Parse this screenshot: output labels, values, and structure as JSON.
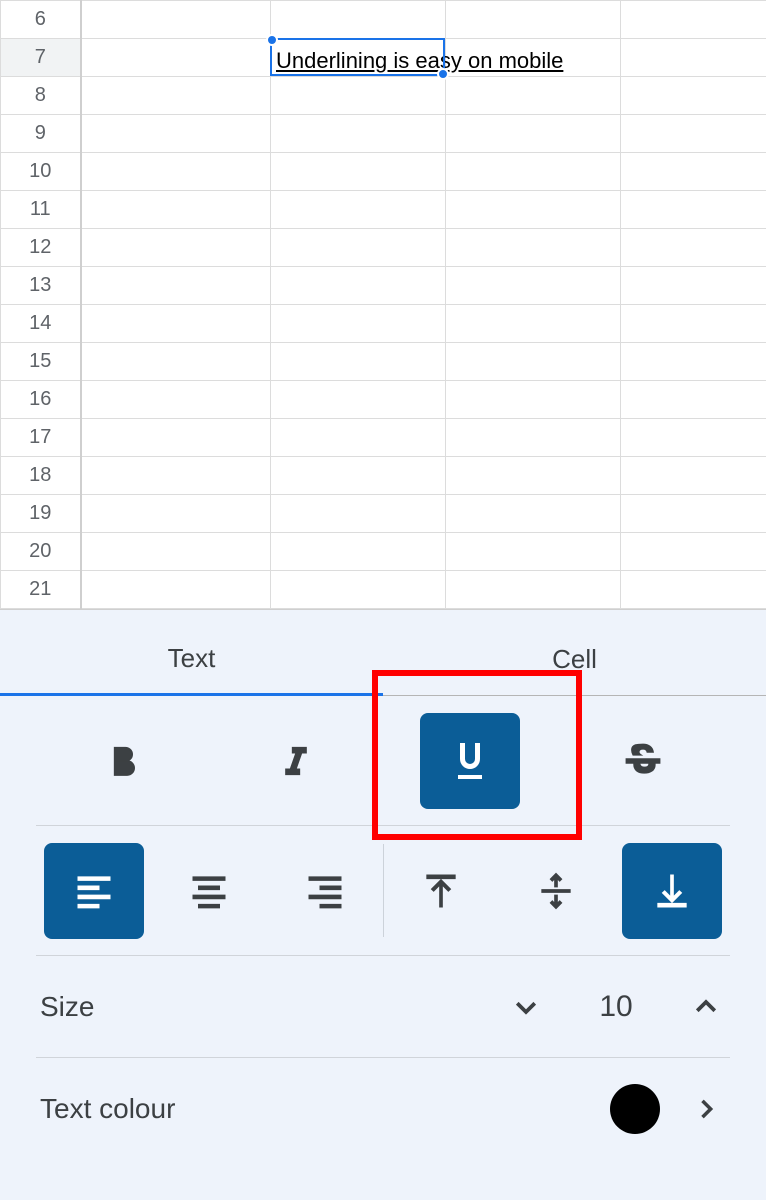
{
  "sheet": {
    "row_headers": [
      "6",
      "7",
      "8",
      "9",
      "10",
      "11",
      "12",
      "13",
      "14",
      "15",
      "16",
      "17",
      "18",
      "19",
      "20",
      "21"
    ],
    "selected_row": "7",
    "selected_cell_value": "Underlining is easy on mobile"
  },
  "panel": {
    "tabs": {
      "text": "Text",
      "cell": "Cell"
    },
    "size_label": "Size",
    "size_value": "10",
    "colour_label": "Text colour"
  }
}
